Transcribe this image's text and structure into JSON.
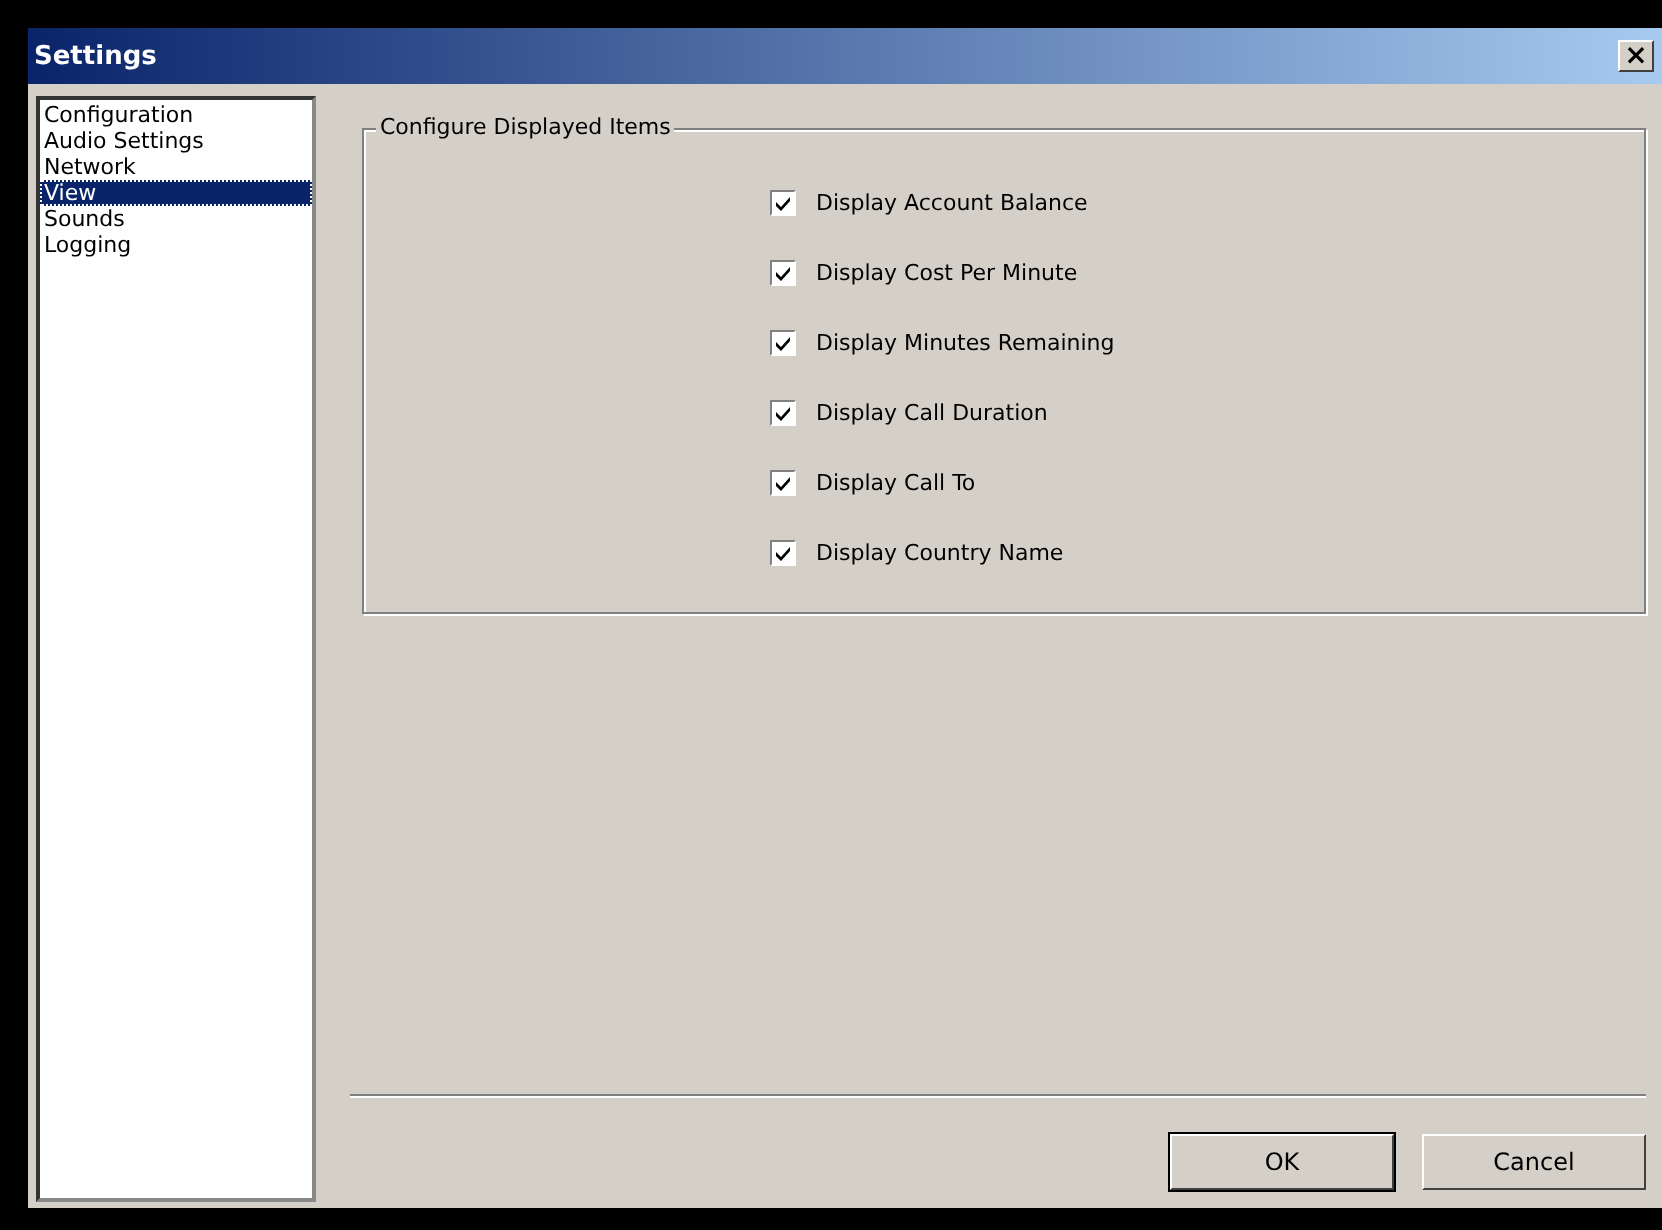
{
  "window": {
    "title": "Settings",
    "close": "×"
  },
  "sidebar": {
    "items": [
      {
        "label": "Configuration",
        "selected": false
      },
      {
        "label": "Audio Settings",
        "selected": false
      },
      {
        "label": "Network",
        "selected": false
      },
      {
        "label": "View",
        "selected": true
      },
      {
        "label": "Sounds",
        "selected": false
      },
      {
        "label": "Logging",
        "selected": false
      }
    ]
  },
  "group": {
    "title": "Configure Displayed Items",
    "options": [
      {
        "label": "Display Account Balance",
        "checked": true
      },
      {
        "label": "Display Cost Per Minute",
        "checked": true
      },
      {
        "label": "Display Minutes Remaining",
        "checked": true
      },
      {
        "label": "Display Call Duration",
        "checked": true
      },
      {
        "label": "Display Call To",
        "checked": true
      },
      {
        "label": "Display Country Name",
        "checked": true
      }
    ]
  },
  "buttons": [
    "OK",
    "Cancel"
  ]
}
